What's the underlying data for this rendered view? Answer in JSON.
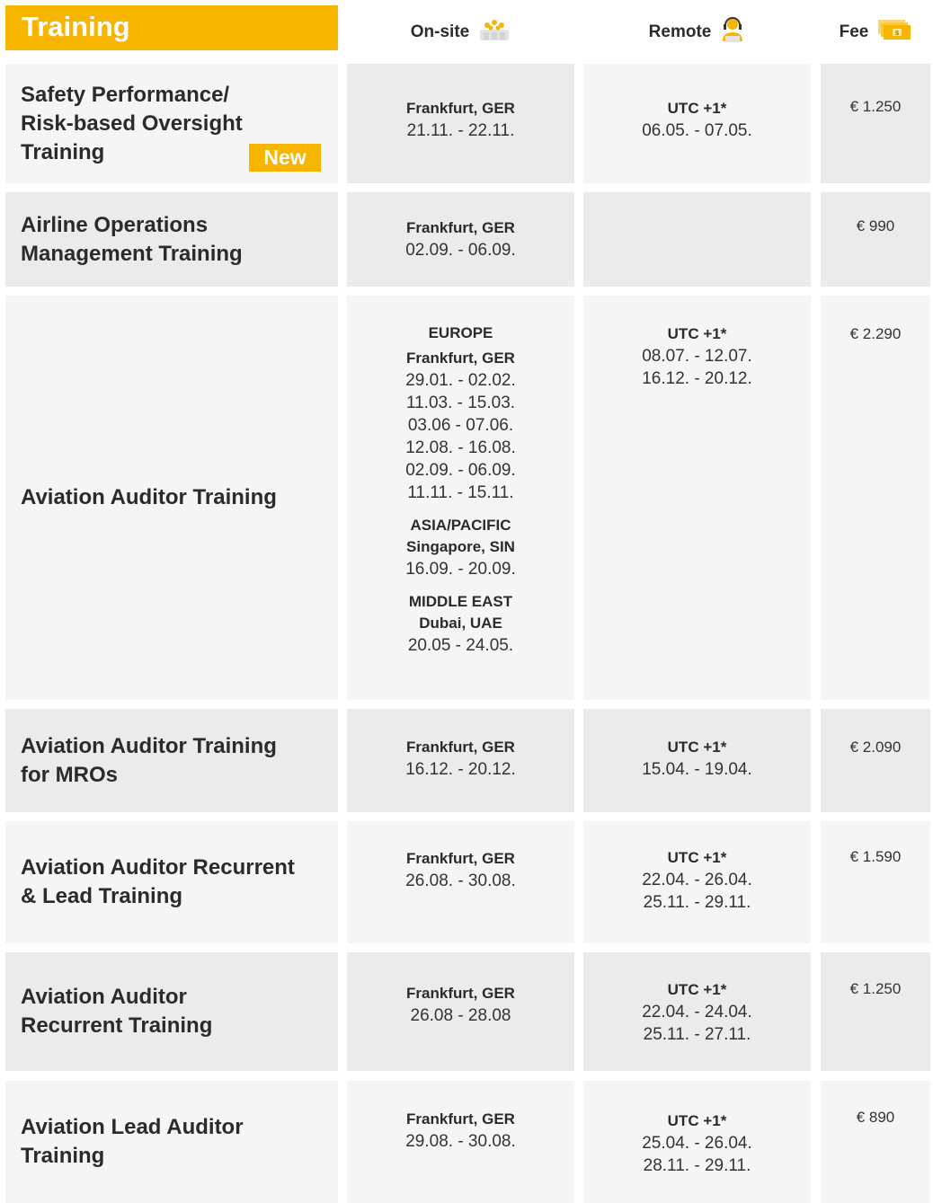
{
  "header": {
    "title": "Training",
    "onsite_label": "On-site",
    "remote_label": "Remote",
    "fee_label": "Fee",
    "icons": {
      "onsite": "group-people-icon",
      "remote": "headset-person-icon",
      "fee": "money-bills-icon"
    },
    "accent_color": "#f7b500"
  },
  "badge": {
    "new_label": "New"
  },
  "rows": [
    {
      "title_lines": [
        "Safety Performance/",
        "Risk-based Oversight",
        "Training"
      ],
      "onsite": {
        "location": "Frankfurt, GER",
        "dates": [
          "21.11. - 22.11."
        ]
      },
      "remote": {
        "tz": "UTC +1*",
        "dates": [
          "06.05. - 07.05."
        ]
      },
      "fee": "€ 1.250"
    },
    {
      "title_lines": [
        "Airline Operations",
        "Management Training"
      ],
      "onsite": {
        "location": "Frankfurt, GER",
        "dates": [
          "02.09. - 06.09."
        ]
      },
      "fee": "€ 990"
    },
    {
      "title_lines": [
        "Aviation Auditor Training"
      ],
      "onsite": {
        "europe": {
          "region": "EUROPE",
          "location": "Frankfurt, GER",
          "dates": [
            "29.01. - 02.02.",
            "11.03. - 15.03.",
            "03.06 - 07.06.",
            "12.08. - 16.08.",
            "02.09. - 06.09.",
            "11.11. - 15.11."
          ]
        },
        "asia": {
          "region": "ASIA/PACIFIC",
          "location": "Singapore, SIN",
          "dates": [
            "16.09. - 20.09."
          ]
        },
        "me": {
          "region": "MIDDLE EAST",
          "location": "Dubai, UAE",
          "dates": [
            "20.05 - 24.05."
          ]
        }
      },
      "remote": {
        "tz": "UTC +1*",
        "dates": [
          "08.07. - 12.07.",
          "16.12. - 20.12."
        ]
      },
      "fee": "€ 2.290"
    },
    {
      "title_lines": [
        "Aviation Auditor Training",
        "for MROs"
      ],
      "onsite": {
        "location": "Frankfurt, GER",
        "dates": [
          "16.12. - 20.12."
        ]
      },
      "remote": {
        "tz": "UTC +1*",
        "dates": [
          "15.04. - 19.04."
        ]
      },
      "fee": "€ 2.090"
    },
    {
      "title_lines": [
        "Aviation Auditor Recurrent",
        "& Lead Training"
      ],
      "onsite": {
        "location": "Frankfurt, GER",
        "dates": [
          "26.08. - 30.08."
        ]
      },
      "remote": {
        "tz": "UTC +1*",
        "dates": [
          "22.04. - 26.04.",
          "25.11. - 29.11."
        ]
      },
      "fee": "€ 1.590"
    },
    {
      "title_lines": [
        "Aviation Auditor",
        "Recurrent Training"
      ],
      "onsite": {
        "location": "Frankfurt, GER",
        "dates": [
          "26.08 - 28.08"
        ]
      },
      "remote": {
        "tz": "UTC +1*",
        "dates": [
          "22.04. - 24.04.",
          "25.11. - 27.11."
        ]
      },
      "fee": "€ 1.250"
    },
    {
      "title_lines": [
        "Aviation Lead Auditor",
        "Training"
      ],
      "onsite": {
        "location": "Frankfurt, GER",
        "dates": [
          "29.08. - 30.08."
        ]
      },
      "remote": {
        "tz": "UTC +1*",
        "dates": [
          "25.04. - 26.04.",
          "28.11. - 29.11."
        ]
      },
      "fee": "€ 890"
    }
  ]
}
